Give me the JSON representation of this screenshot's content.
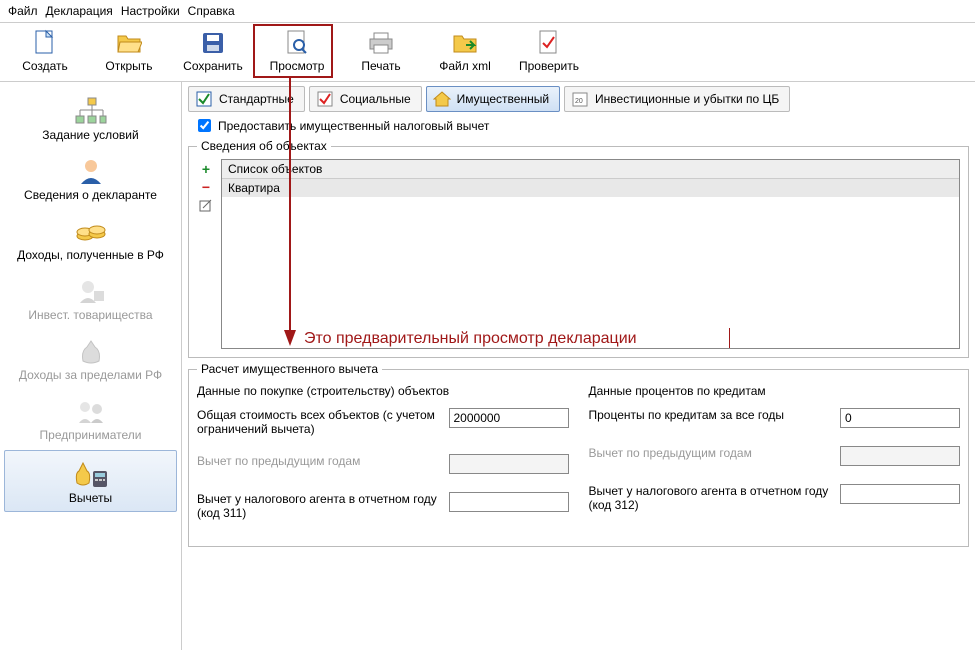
{
  "menu": {
    "items": [
      "Файл",
      "Декларация",
      "Настройки",
      "Справка"
    ]
  },
  "toolbar": {
    "create": "Создать",
    "open": "Открыть",
    "save": "Сохранить",
    "preview": "Просмотр",
    "print": "Печать",
    "filexml": "Файл xml",
    "check": "Проверить"
  },
  "sidebar": {
    "conditions": "Задание условий",
    "declarant": "Сведения о декларанте",
    "income_rf": "Доходы, полученные в РФ",
    "invest": "Инвест. товарищества",
    "income_abroad": "Доходы за пределами РФ",
    "entrepreneurs": "Предприниматели",
    "deductions": "Вычеты"
  },
  "tabs": {
    "standard": "Стандартные",
    "social": "Социальные",
    "property": "Имущественный",
    "invest_losses": "Инвестиционные и убытки по ЦБ"
  },
  "provide_checkbox": "Предоставить имущественный налоговый вычет",
  "objects": {
    "legend": "Сведения об объектах",
    "header": "Список объектов",
    "item0": "Квартира"
  },
  "calc": {
    "legend": "Расчет имущественного вычета",
    "purchase_title": "Данные по покупке (строительству) объектов",
    "interest_title": "Данные процентов по кредитам",
    "total_cost_label": "Общая стоимость всех объектов (с учетом ограничений вычета)",
    "total_cost_value": "2000000",
    "interest_label": "Проценты по кредитам за все годы",
    "interest_value": "0",
    "prev_years_label": "Вычет по предыдущим годам",
    "agent_311_label": "Вычет у налогового агента в отчетном году (код 311)",
    "agent_312_label": "Вычет у налогового агента в отчетном году (код 312)"
  },
  "annotation_text": "Это предварительный просмотр декларации"
}
